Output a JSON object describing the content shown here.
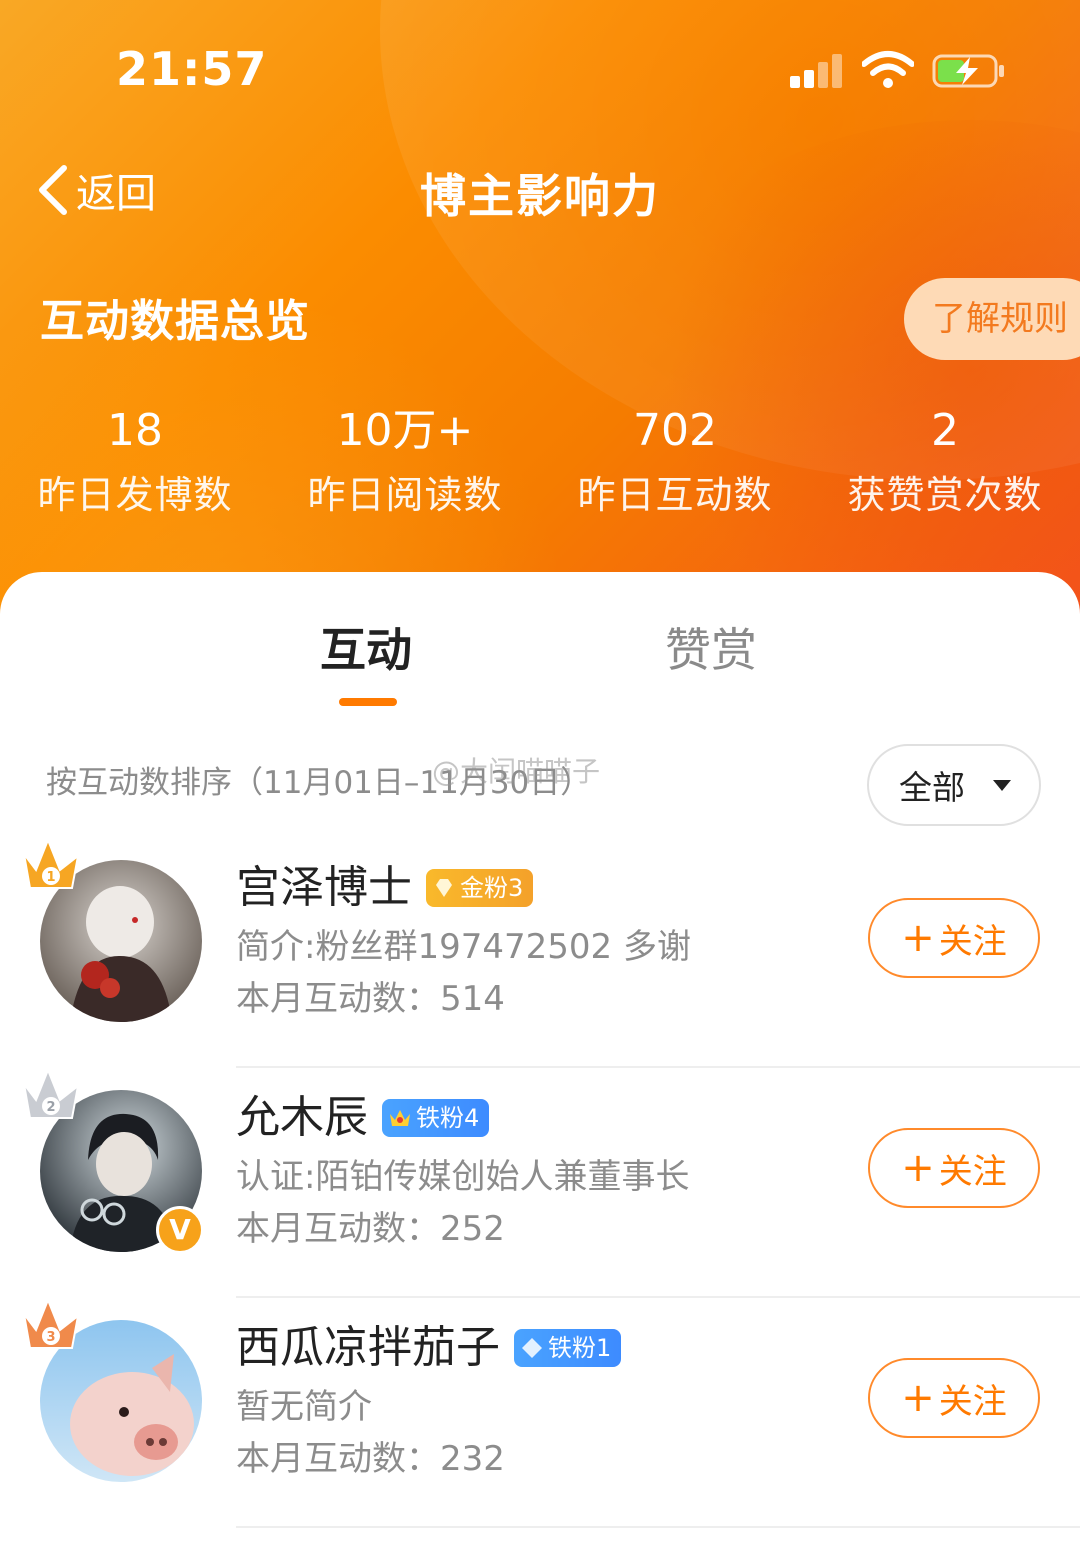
{
  "status_bar": {
    "time": "21:57"
  },
  "nav": {
    "back_label": "返回",
    "title": "博主影响力"
  },
  "overview": {
    "title": "互动数据总览",
    "rules_button": "了解规则",
    "stats": [
      {
        "value": "18",
        "label": "昨日发博数"
      },
      {
        "value": "10万+",
        "label": "昨日阅读数"
      },
      {
        "value": "702",
        "label": "昨日互动数"
      },
      {
        "value": "2",
        "label": "获赞赏次数"
      }
    ]
  },
  "tabs": [
    {
      "label": "互动",
      "active": true
    },
    {
      "label": "赞赏",
      "active": false
    }
  ],
  "sort": {
    "label": "按互动数排序（11月01日–11月30日）",
    "filter_value": "全部"
  },
  "watermark": "@大闰喵喵子",
  "list": [
    {
      "rank": "1",
      "name": "宫泽博士",
      "badge": "金粉3",
      "badge_color": "#f7a926",
      "intro": "简介:粉丝群197472502 多谢",
      "count_label": "本月互动数：",
      "count": "514",
      "follow_label": "关注",
      "verified": false
    },
    {
      "rank": "2",
      "name": "允木辰",
      "badge": "铁粉4",
      "badge_color": "#3d8bff",
      "intro": "认证:陌铂传媒创始人兼董事长",
      "count_label": "本月互动数：",
      "count": "252",
      "follow_label": "关注",
      "verified": true,
      "verified_mark": "V"
    },
    {
      "rank": "3",
      "name": "西瓜凉拌茄子",
      "badge": "铁粉1",
      "badge_color": "#3d8bff",
      "intro": "暂无简介",
      "count_label": "本月互动数：",
      "count": "232",
      "follow_label": "关注",
      "verified": false
    }
  ],
  "colors": {
    "accent": "#ff7a00",
    "header_start": "#f9a825",
    "header_end": "#f4511e"
  }
}
